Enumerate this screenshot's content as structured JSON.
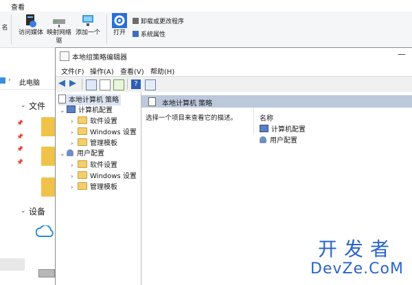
{
  "explorer": {
    "tab": "查看",
    "ribbon": {
      "left_cut": "名",
      "media": "访问媒体",
      "map_drive": "映射网络",
      "map_drive_2": "驱",
      "add_location": "添加一个",
      "open": "打开",
      "uninstall": "卸载或更改程序",
      "system_props": "系统属性"
    },
    "address": "此电脑",
    "nav_head_files": "文件",
    "nav_head_devices": "设备"
  },
  "gpedit": {
    "title": "本地组策略编辑器",
    "menu": [
      "文件(F)",
      "操作(A)",
      "查看(V)",
      "帮助(H)"
    ],
    "tree": {
      "root": "本地计算机 策略",
      "computer_config": "计算机配置",
      "user_config": "用户配置",
      "software_settings": "软件设置",
      "windows_settings": "Windows 设置",
      "admin_templates": "管理模板"
    },
    "right": {
      "header": "本地计算机 策略",
      "description": "选择一个项目来查看它的描述。",
      "column_name": "名称",
      "items": [
        "计算机配置",
        "用户配置"
      ]
    }
  },
  "watermark": {
    "line1": "开发者",
    "line2": "DevZe.CoM"
  },
  "colors": {
    "accent": "#2a63c9",
    "header_bg": "#bcc8dc",
    "folder": "#f3cf6b"
  }
}
